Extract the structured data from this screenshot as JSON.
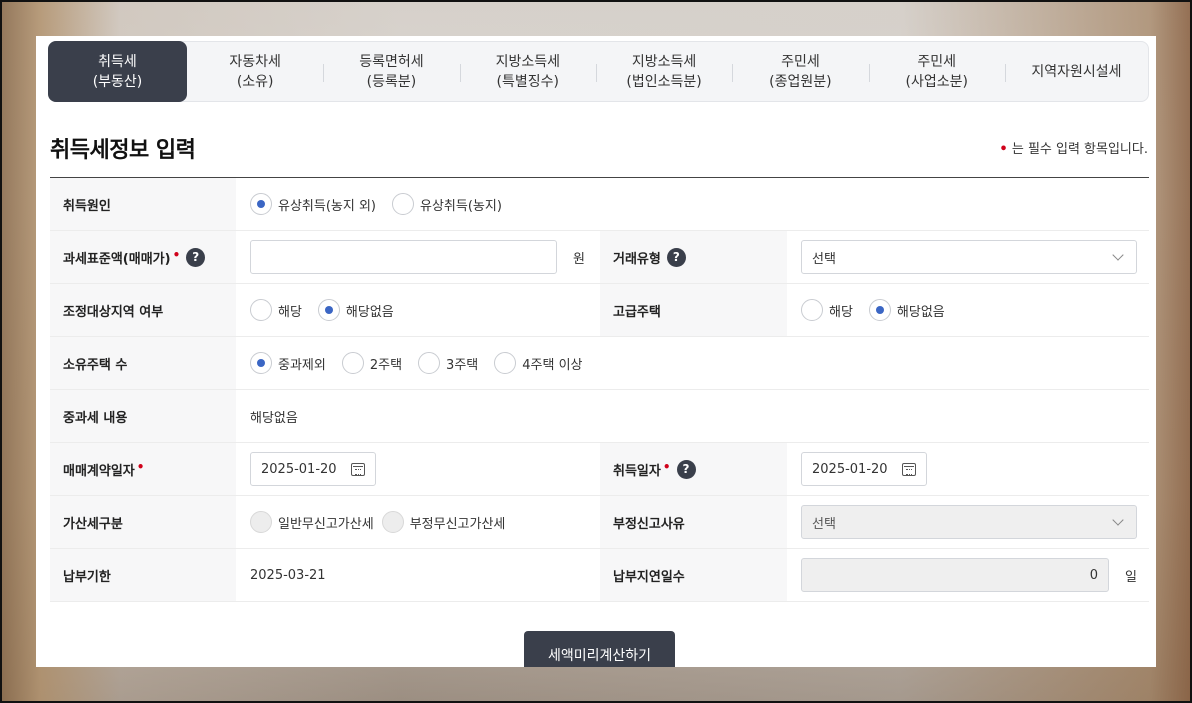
{
  "tabs": [
    {
      "line1": "취득세",
      "line2": "(부동산)",
      "active": true
    },
    {
      "line1": "자동차세",
      "line2": "(소유)"
    },
    {
      "line1": "등록면허세",
      "line2": "(등록분)"
    },
    {
      "line1": "지방소득세",
      "line2": "(특별징수)"
    },
    {
      "line1": "지방소득세",
      "line2": "(법인소득분)"
    },
    {
      "line1": "주민세",
      "line2": "(종업원분)"
    },
    {
      "line1": "주민세",
      "line2": "(사업소분)"
    },
    {
      "line1": "지역자원시설세",
      "line2": ""
    }
  ],
  "heading": "취득세정보 입력",
  "required_note": {
    "dot": "•",
    "text": "는 필수 입력 항목입니다."
  },
  "form": {
    "acquisition_cause": {
      "label": "취득원인",
      "options": [
        "유상취득(농지 외)",
        "유상취득(농지)"
      ],
      "selected": 0
    },
    "tax_base": {
      "label": "과세표준액(매매가)",
      "required_mark": "•",
      "help": "?",
      "value": "",
      "unit": "원"
    },
    "deal_type": {
      "label": "거래유형",
      "help": "?",
      "selected": "선택"
    },
    "adjusted_area": {
      "label": "조정대상지역 여부",
      "options": [
        "해당",
        "해당없음"
      ],
      "selected": 1
    },
    "luxury_house": {
      "label": "고급주택",
      "options": [
        "해당",
        "해당없음"
      ],
      "selected": 1
    },
    "house_count": {
      "label": "소유주택 수",
      "options": [
        "중과제외",
        "2주택",
        "3주택",
        "4주택 이상"
      ],
      "selected": 0
    },
    "heavy_tax": {
      "label": "중과세 내용",
      "value": "해당없음"
    },
    "contract_date": {
      "label": "매매계약일자",
      "required_mark": "•",
      "value": "2025-01-20"
    },
    "acquisition_date": {
      "label": "취득일자",
      "required_mark": "•",
      "help": "?",
      "value": "2025-01-20"
    },
    "penalty_type": {
      "label": "가산세구분",
      "options": [
        "일반무신고가산세",
        "부정무신고가산세"
      ]
    },
    "unfair_reason": {
      "label": "부정신고사유",
      "selected": "선택"
    },
    "due_date": {
      "label": "납부기한",
      "value": "2025-03-21"
    },
    "delay_days": {
      "label": "납부지연일수",
      "value": "0",
      "unit": "일"
    }
  },
  "calc_button": "세액미리계산하기",
  "colors": {
    "accent": "#3a3f4b",
    "radio_on": "#3b66c4",
    "required": "#d0021b"
  }
}
